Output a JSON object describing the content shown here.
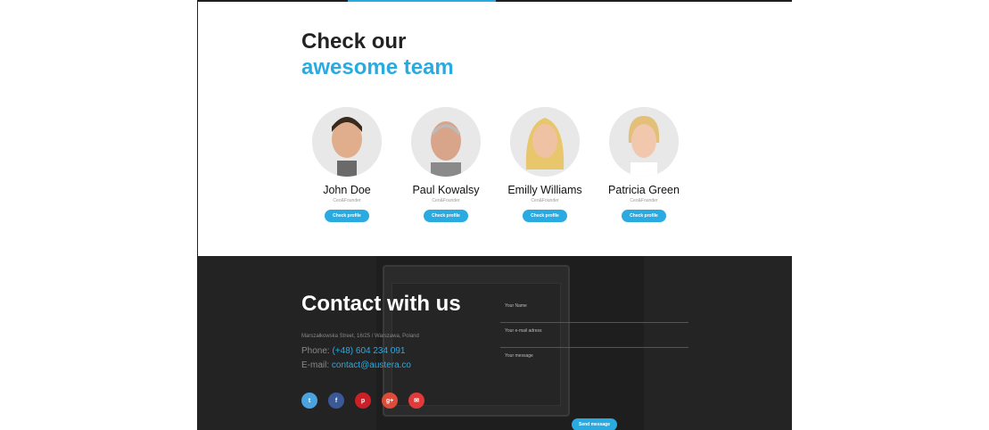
{
  "team": {
    "heading_line1": "Check our",
    "heading_line2": "awesome team",
    "members": [
      {
        "name": "John Doe",
        "role": "Ceo&Founder",
        "button": "Check profile"
      },
      {
        "name": "Paul Kowalsy",
        "role": "Ceo&Founder",
        "button": "Check profile"
      },
      {
        "name": "Emilly Williams",
        "role": "Ceo&Founder",
        "button": "Check profile"
      },
      {
        "name": "Patricia Green",
        "role": "Ceo&Founder",
        "button": "Check profile"
      }
    ]
  },
  "contact": {
    "title": "Contact with us",
    "address": "Marszałkowska Street, 16/25 / Warszawa, Poland",
    "phone_label": "Phone:",
    "phone_value": "(+48) 604 234 091",
    "email_label": "E-mail:",
    "email_value": "contact@austera.co",
    "socials": [
      {
        "icon": "twitter-icon",
        "glyph": "t",
        "color": "#4aa3df"
      },
      {
        "icon": "facebook-icon",
        "glyph": "f",
        "color": "#3b5998"
      },
      {
        "icon": "pinterest-icon",
        "glyph": "p",
        "color": "#cb2027"
      },
      {
        "icon": "google-plus-icon",
        "glyph": "g+",
        "color": "#dd4b39"
      },
      {
        "icon": "mail-icon",
        "glyph": "✉",
        "color": "#e03a3a"
      }
    ],
    "form": {
      "name_placeholder": "Your Name",
      "email_placeholder": "Your e-mail adress",
      "message_placeholder": "Your message",
      "send_label": "Send message"
    }
  },
  "colors": {
    "accent": "#29abe2",
    "dark": "#1e1e1e"
  }
}
